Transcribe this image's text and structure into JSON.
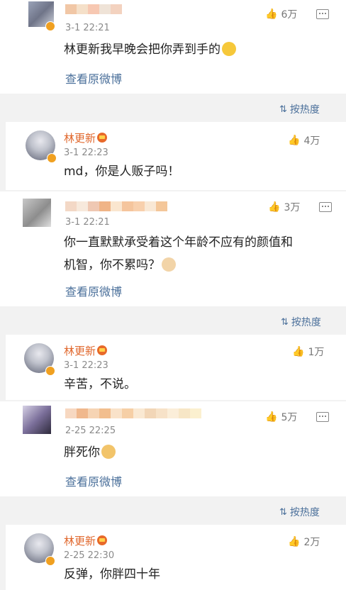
{
  "comments": [
    {
      "time": "3-1 22:21",
      "text": "林更新我早晚会把你弄到手的",
      "likes": "6万",
      "view_original": "查看原微博"
    },
    {
      "sort_label": "按热度",
      "reply": {
        "name": "林更新",
        "time": "3-1 22:23",
        "text": "md，你是人贩子吗！",
        "likes": "4万"
      }
    },
    {
      "time": "3-1 22:21",
      "text_line1": "你一直默默承受着这个年龄不应有的颜值和",
      "text_line2": "机智，你不累吗？",
      "likes": "3万",
      "view_original": "查看原微博"
    },
    {
      "sort_label": "按热度",
      "reply": {
        "name": "林更新",
        "time": "3-1 22:23",
        "text": "辛苦，不说。",
        "likes": "1万"
      }
    },
    {
      "time": "2-25 22:25",
      "text": "胖死你",
      "likes": "5万",
      "view_original": "查看原微博"
    },
    {
      "sort_label": "按热度",
      "reply": {
        "name": "林更新",
        "time": "2-25 22:30",
        "text": "反弹，你胖四十年",
        "likes": "2万"
      }
    }
  ],
  "colors": {
    "name_orange": "#e0662b",
    "link_blue": "#4a6f9a",
    "band_gray": "#f2f2f2"
  },
  "icons": [
    "thumbs-up-icon",
    "comment-icon",
    "sort-icon",
    "verified-badge-icon",
    "crown-icon",
    "smile-emoji",
    "cat-emoji",
    "dog-emoji"
  ]
}
